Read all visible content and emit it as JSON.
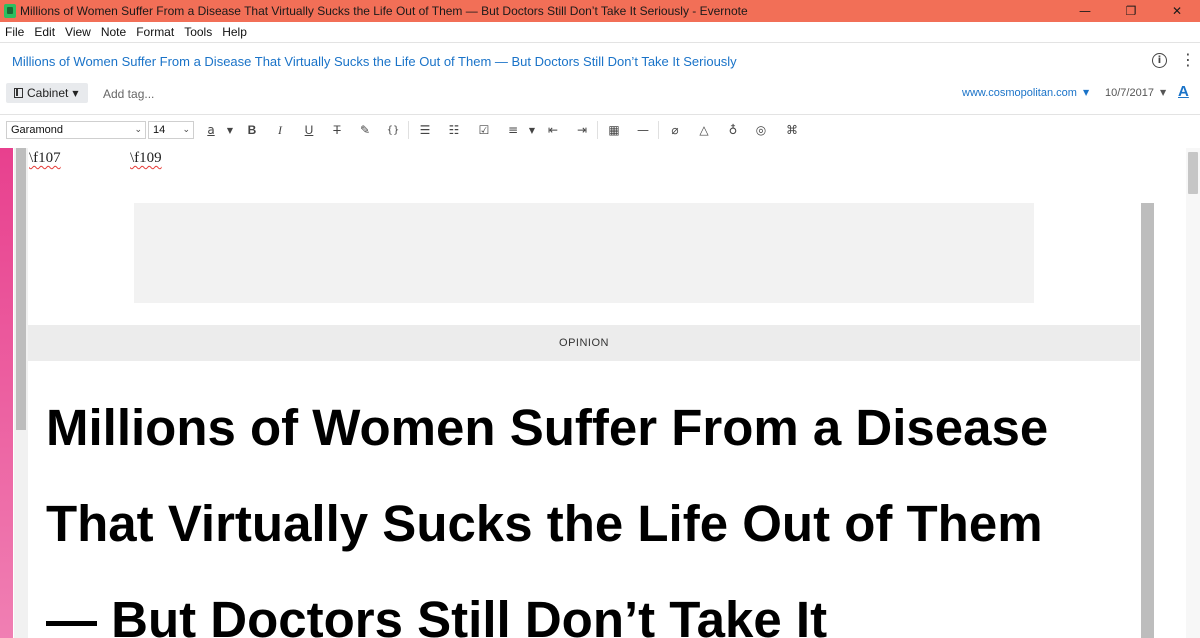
{
  "window": {
    "title": "Millions of Women Suffer From a Disease That Virtually Sucks the Life Out of Them — But Doctors Still Don’t Take It Seriously - Evernote",
    "minimize_glyph": "—",
    "maximize_glyph": "❐",
    "close_glyph": "✕"
  },
  "menu": [
    "File",
    "Edit",
    "View",
    "Note",
    "Format",
    "Tools",
    "Help"
  ],
  "note": {
    "title": "Millions of Women Suffer From a Disease That Virtually Sucks the Life Out of Them — But Doctors Still Don’t Take It Seriously",
    "info_glyph": "i",
    "more_glyph": "⋮"
  },
  "meta": {
    "notebook": "Cabinet",
    "tag_placeholder": "Add tag...",
    "source": "www.cosmopolitan.com",
    "date": "10/7/2017",
    "font_color_glyph": "A"
  },
  "toolbar": {
    "font": "Garamond",
    "size": "14",
    "highlight_glyph": "a",
    "bold": "B",
    "italic": "I",
    "underline": "U",
    "strike": "T",
    "eraser": "✎",
    "code": "{}",
    "bullets": "☰",
    "numbers": "☷",
    "checkbox": "☑",
    "align": "≡",
    "outdent": "⇤",
    "indent": "⇥",
    "table": "▦",
    "rule": "—",
    "attach": "⌀",
    "drive": "△",
    "record": "♁",
    "sketch": "◎",
    "more": "⌘"
  },
  "content": {
    "code_1": "\\f107",
    "code_2": "\\f109",
    "section_label": "OPINION",
    "headline_lines": [
      "Millions of Women Suffer From a Disease",
      "That Virtually Sucks the Life Out of Them",
      "— But Doctors Still Don’t Take It"
    ]
  },
  "colors": {
    "titlebar": "#f26f57",
    "link": "#1a73c8",
    "accent_strip": "#e8408e"
  }
}
